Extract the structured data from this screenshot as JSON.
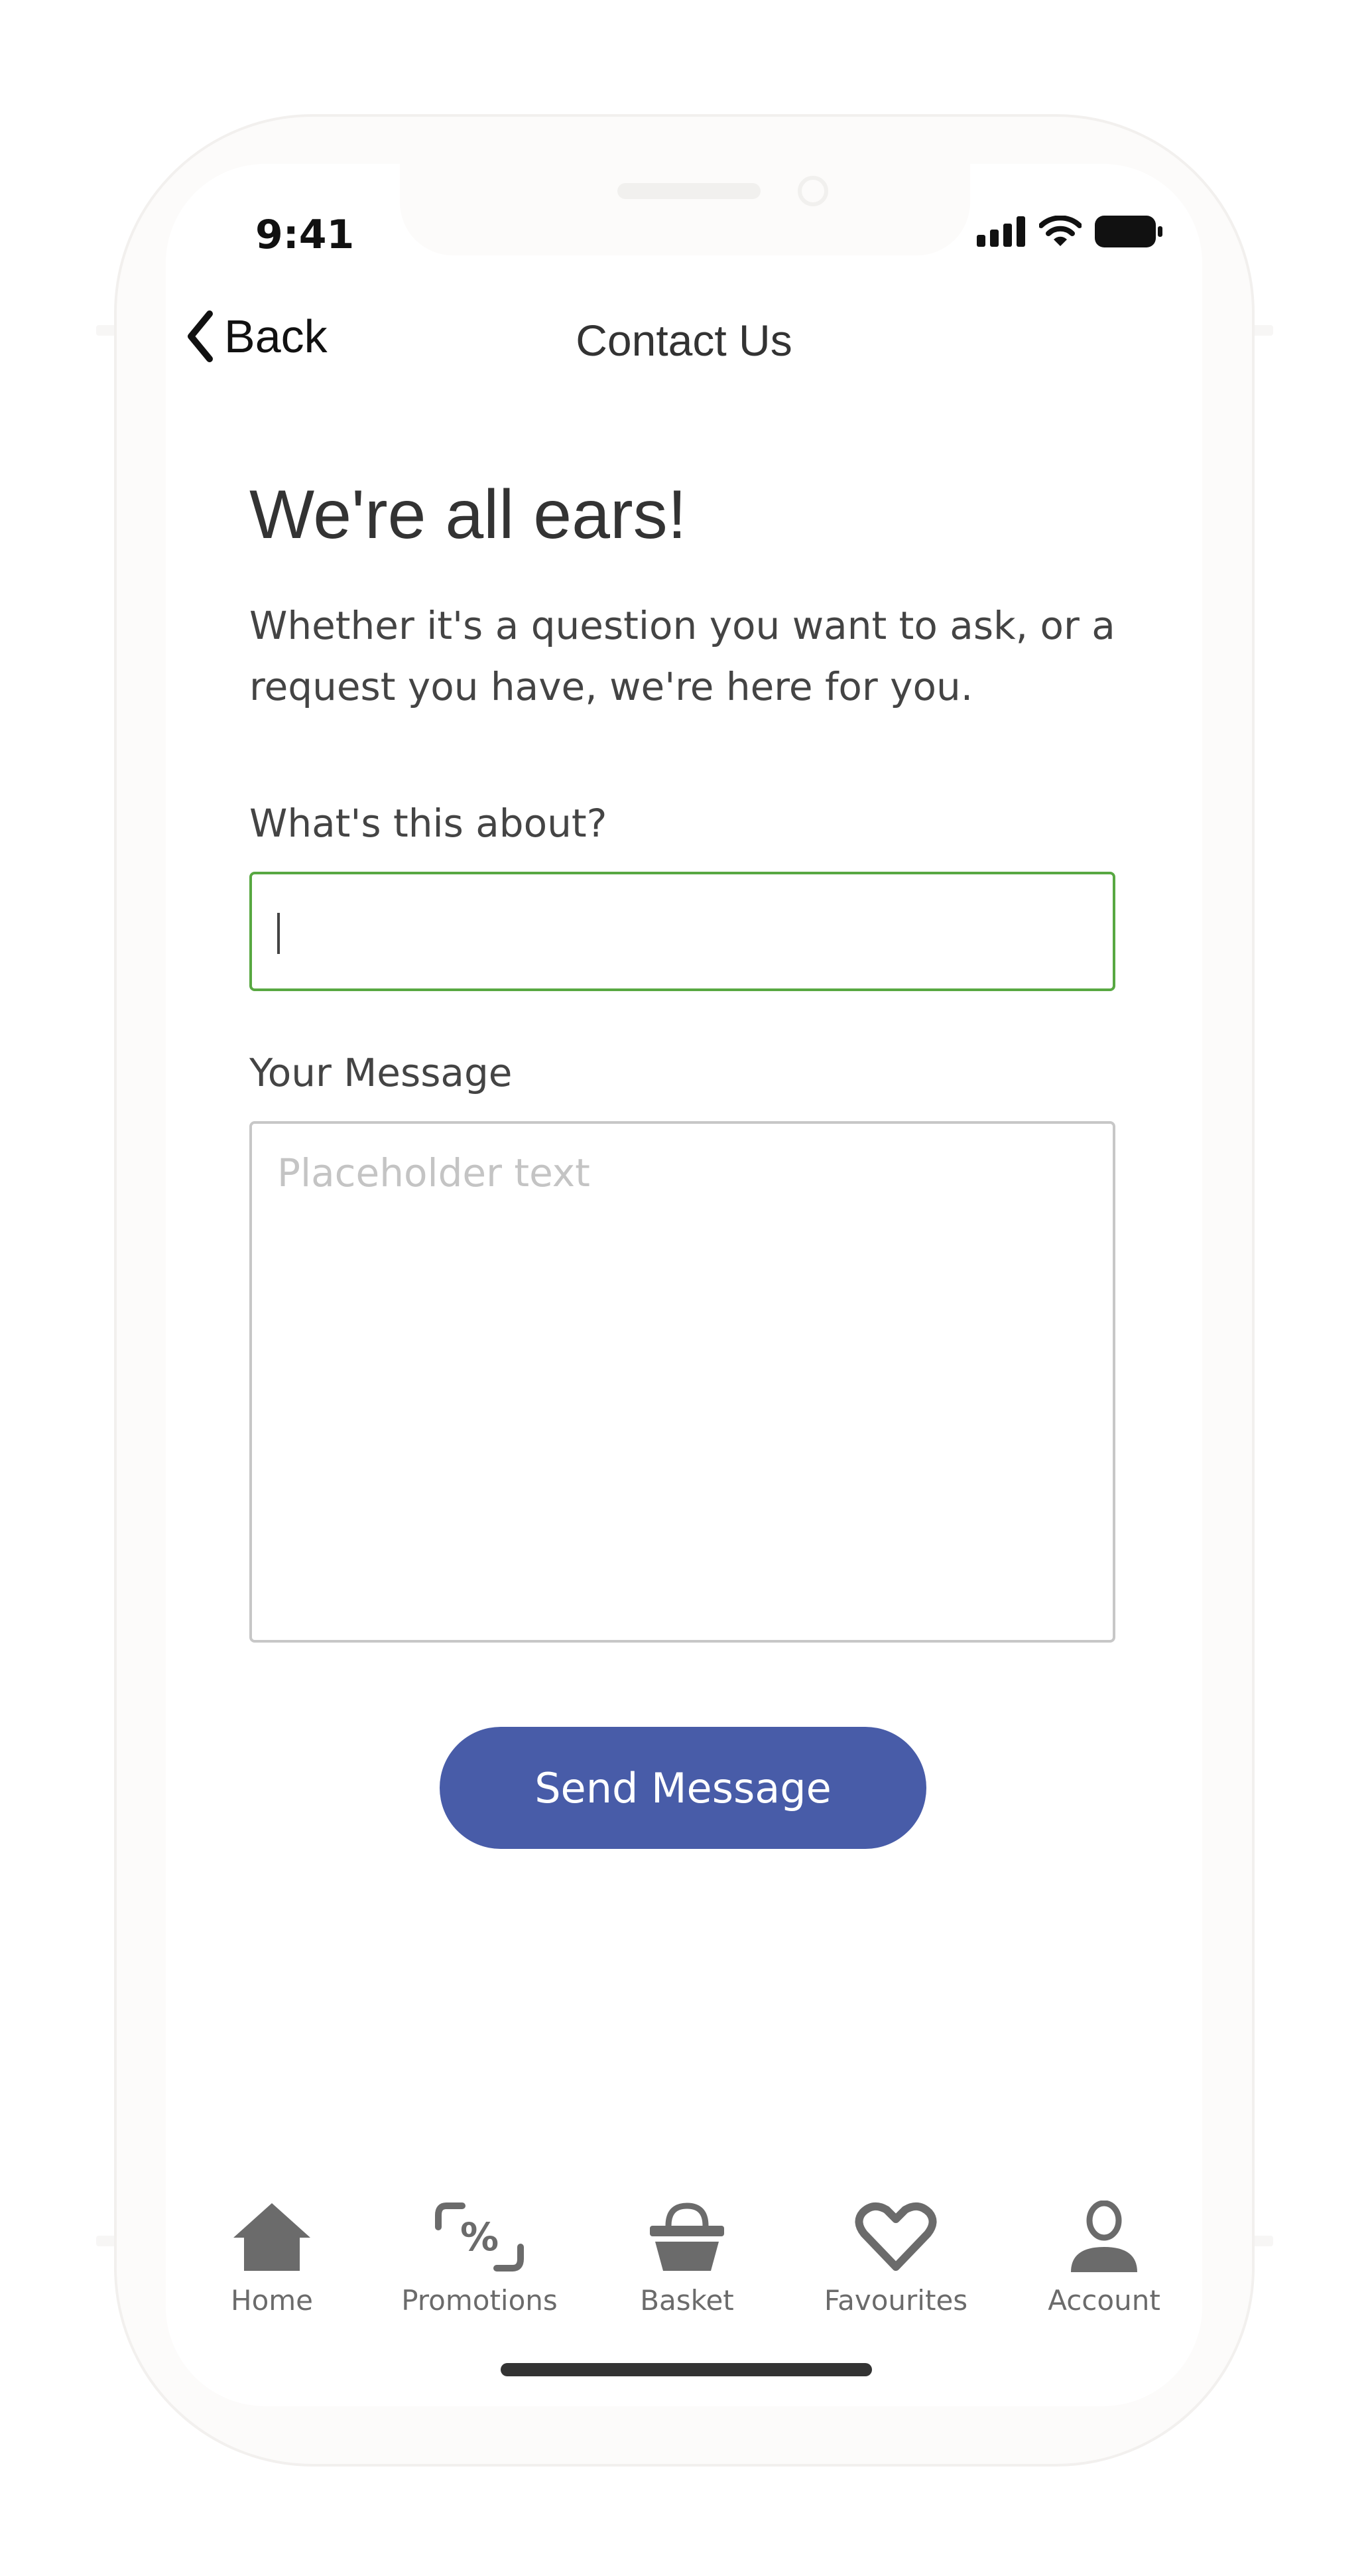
{
  "status_bar": {
    "time": "9:41"
  },
  "nav": {
    "back_label": "Back",
    "title": "Contact Us"
  },
  "content": {
    "heading": "We're all ears!",
    "subtitle": "Whether it's a question you want to ask, or a request you have, we're here for you.",
    "subject_label": "What's this about?",
    "subject_value": "",
    "message_label": "Your Message",
    "message_placeholder": "Placeholder text",
    "send_label": "Send Message"
  },
  "tabbar": {
    "items": [
      {
        "label": "Home",
        "icon": "home-icon"
      },
      {
        "label": "Promotions",
        "icon": "percent-icon"
      },
      {
        "label": "Basket",
        "icon": "basket-icon"
      },
      {
        "label": "Favourites",
        "icon": "heart-icon"
      },
      {
        "label": "Account",
        "icon": "user-icon"
      }
    ]
  },
  "colors": {
    "accent": "#485ca8",
    "focus_border": "#58a842",
    "text": "#333333",
    "icon": "#6b6b6b"
  }
}
